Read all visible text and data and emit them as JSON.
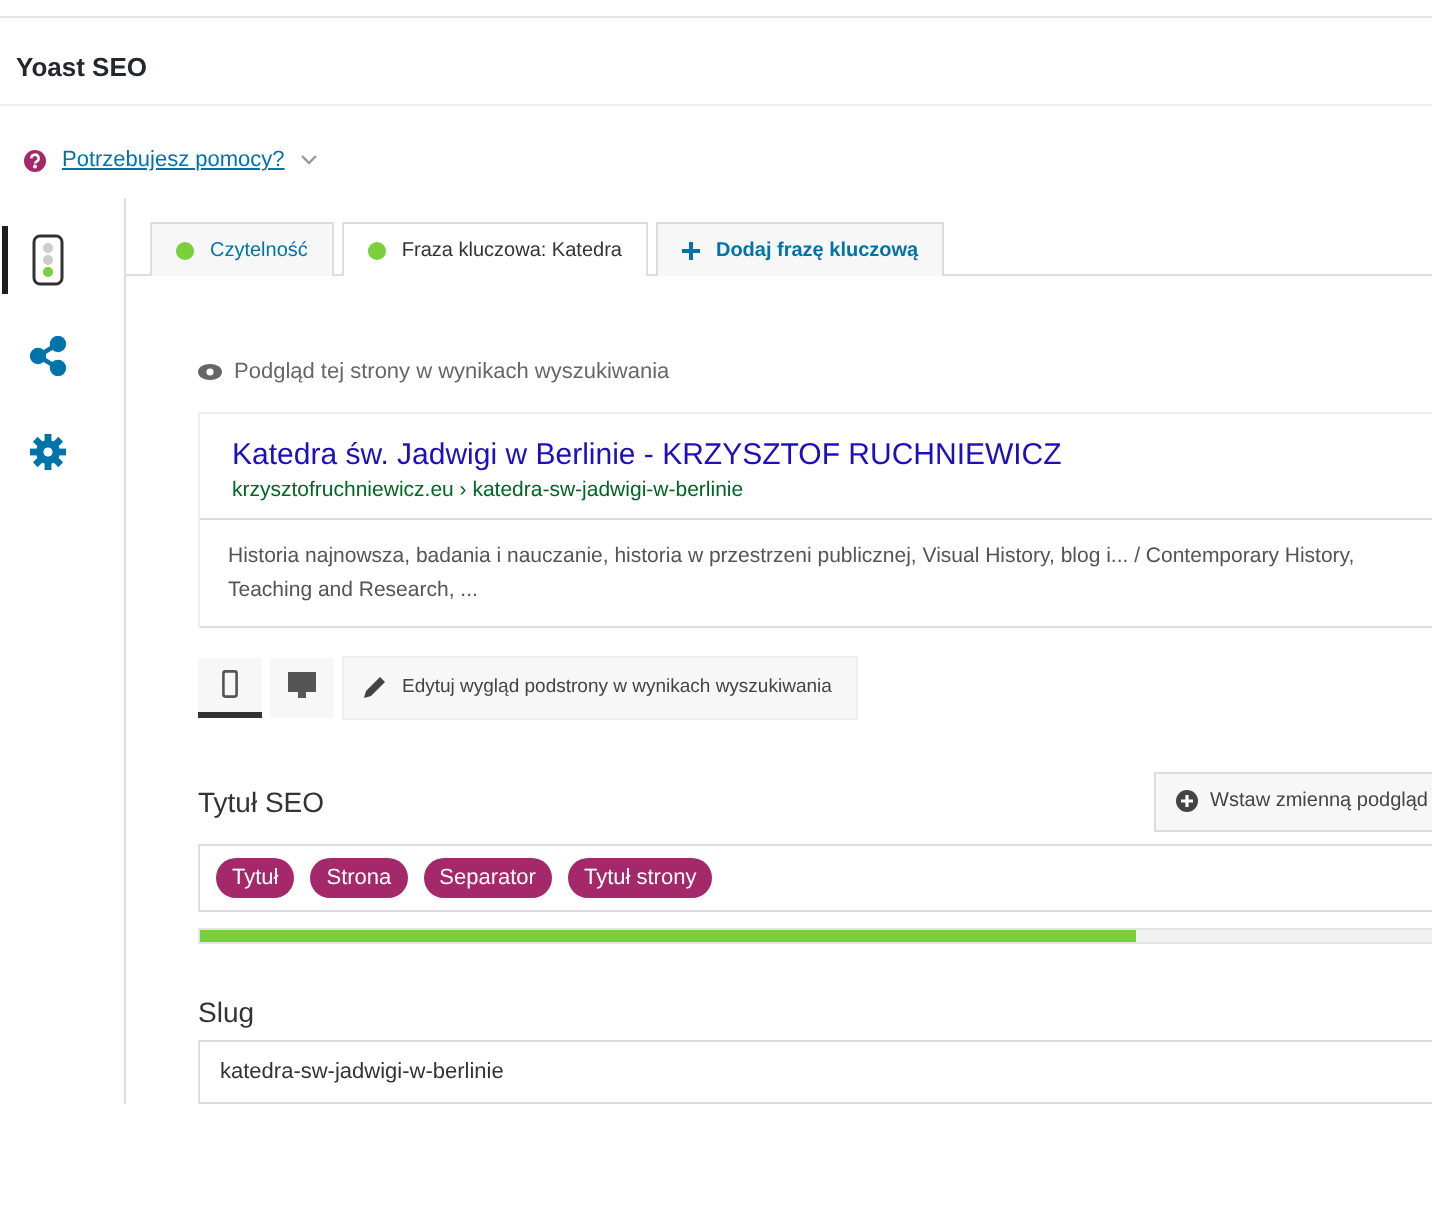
{
  "panel": {
    "title": "Yoast SEO"
  },
  "help": {
    "label": "Potrzebujesz pomocy?",
    "expanded": false
  },
  "side_tabs": [
    {
      "kind": "traffic",
      "selected": true
    },
    {
      "kind": "share",
      "selected": false
    },
    {
      "kind": "gear",
      "selected": false
    }
  ],
  "tabs": [
    {
      "kind": "score",
      "label": "Czytelność",
      "selected": false,
      "color": "#7ad03a"
    },
    {
      "kind": "score",
      "label": "Fraza kluczowa: Katedra",
      "selected": true,
      "color": "#7ad03a"
    },
    {
      "kind": "add",
      "label": "Dodaj frazę kluczową",
      "selected": false
    }
  ],
  "preview": {
    "heading": "Podgląd tej strony w wynikach wyszukiwania",
    "title": "Katedra św. Jadwigi w Berlinie - KRZYSZTOF RUCHNIEWICZ",
    "url": "krzysztofruchniewicz.eu › katedra-sw-jadwigi-w-berlinie",
    "description": "Historia najnowsza, badania i nauczanie, historia w przestrzeni publicznej, Visual History, blog i... / Contemporary History, Teaching and Research, ..."
  },
  "devices": [
    {
      "kind": "mobile",
      "selected": true
    },
    {
      "kind": "desktop",
      "selected": false
    }
  ],
  "edit_button": "Edytuj wygląd podstrony w wynikach wyszukiwania",
  "seo_title": {
    "label": "Tytuł SEO",
    "insert_button": "Wstaw zmienną podgląd",
    "tags": [
      "Tytuł",
      "Strona",
      "Separator",
      "Tytuł strony"
    ],
    "level": 0.76
  },
  "slug": {
    "label": "Slug",
    "value": "katedra-sw-jadwigi-w-berlinie"
  }
}
